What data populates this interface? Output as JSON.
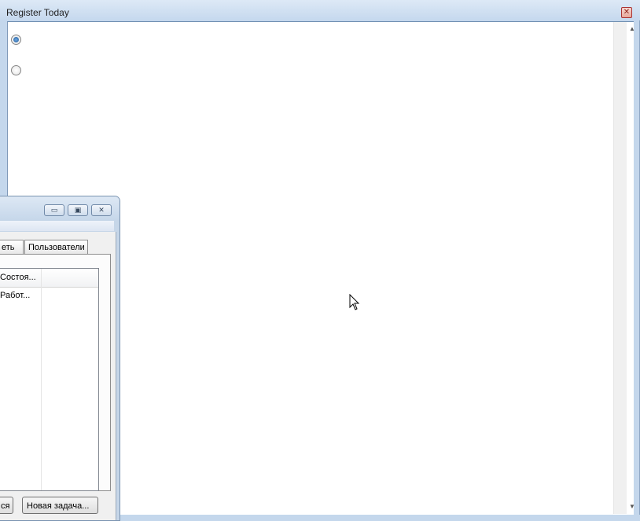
{
  "register_window": {
    "title": "Register Today",
    "close_glyph": "✕",
    "radios": [
      {
        "checked": true
      },
      {
        "checked": false
      }
    ],
    "scroll_up_glyph": "▲",
    "scroll_down_glyph": "▼"
  },
  "task_manager": {
    "minimize_glyph": "▭",
    "restore_glyph": "▣",
    "close_glyph": "✕",
    "tabs": [
      "еть",
      "Пользователи"
    ],
    "columns": [
      "Состоя..."
    ],
    "rows": [
      [
        "Работ..."
      ]
    ],
    "buttons": {
      "left_partial": "ся",
      "new_task": "Новая задача..."
    }
  },
  "icons": {
    "cursor": "mouse-pointer-icon"
  }
}
